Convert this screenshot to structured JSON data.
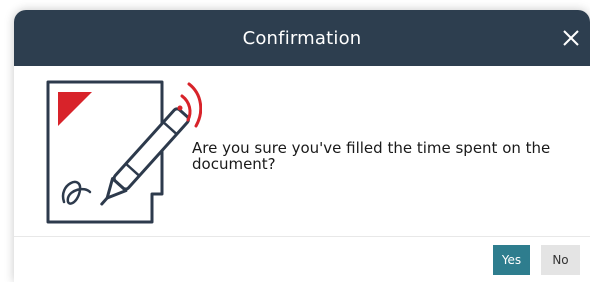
{
  "dialog": {
    "title": "Confirmation",
    "message": "Are you sure you've filled the time spent on the document?",
    "buttons": {
      "yes_label": "Yes",
      "no_label": "No"
    },
    "icons": {
      "close": "close-icon",
      "illustration": "document-signature-pen-icon"
    }
  },
  "colors": {
    "header_bg": "#2d3e4f",
    "yes_button_bg": "#2e7d8e",
    "no_button_bg": "#e4e4e4",
    "accent_red": "#d8232a",
    "illustration_ink": "#2d3a4c"
  }
}
